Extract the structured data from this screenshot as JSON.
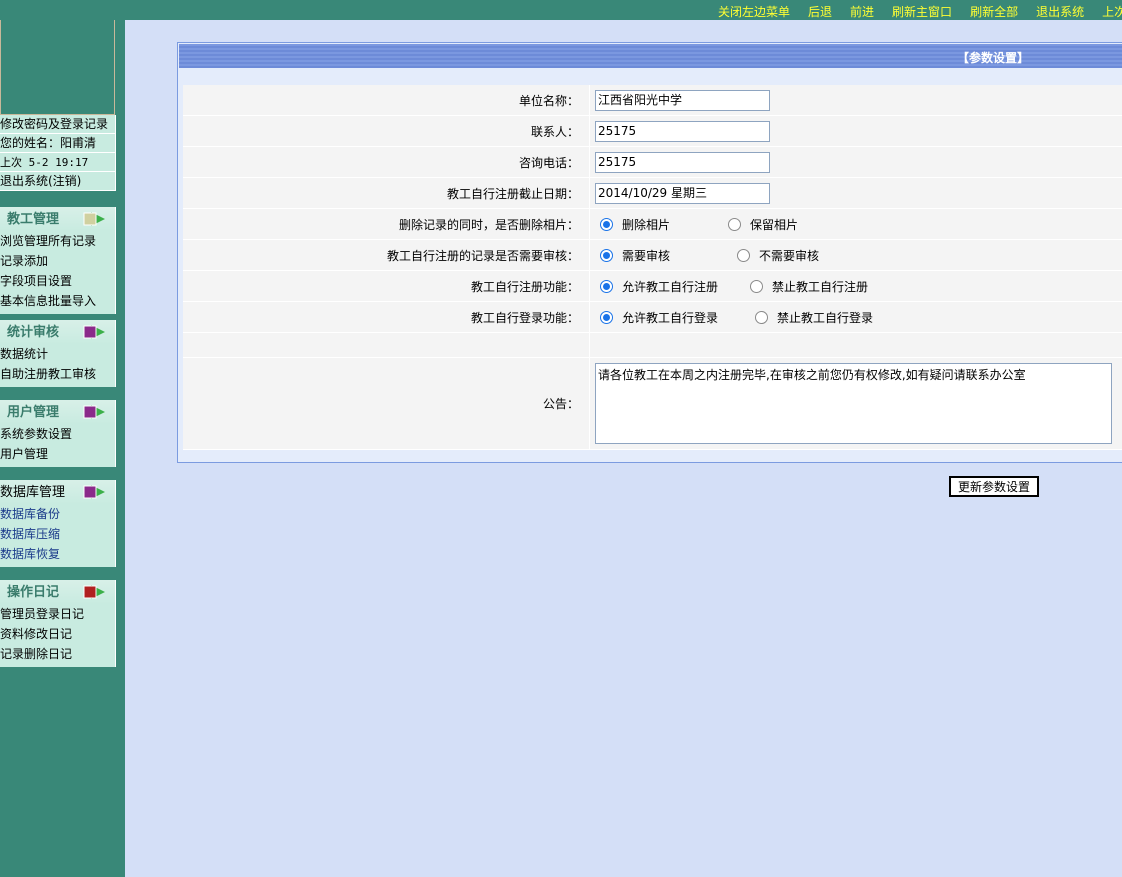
{
  "topbar": {
    "links": [
      "关闭左边菜单",
      "后退",
      "前进",
      "刷新主窗口",
      "刷新全部",
      "退出系统",
      "上次登录"
    ]
  },
  "sidebar": {
    "account": [
      "修改密码及登录记录",
      "您的姓名：阳甫清",
      "上次 5-2 19:17",
      "退出系统(注销)"
    ],
    "sections": [
      {
        "title": "教工管理",
        "items": [
          "浏览管理所有记录",
          "记录添加",
          "字段项目设置",
          "基本信息批量导入"
        ]
      },
      {
        "title": "统计审核",
        "items": [
          "数据统计",
          "自助注册教工审核"
        ]
      },
      {
        "title": "用户管理",
        "items": [
          "系统参数设置",
          "用户管理"
        ]
      },
      {
        "title": "数据库管理",
        "items": [
          "数据库备份",
          "数据库压缩",
          "数据库恢复"
        ]
      },
      {
        "title": "操作日记",
        "items": [
          "管理员登录日记",
          "资料修改日记",
          "记录删除日记"
        ]
      }
    ]
  },
  "panel": {
    "title": "【参数设置】",
    "fields": [
      {
        "label": "单位名称：",
        "value": "江西省阳光中学"
      },
      {
        "label": "联系人：",
        "value": "25175"
      },
      {
        "label": "咨询电话：",
        "value": "25175"
      },
      {
        "label": "教工自行注册截止日期：",
        "value": "2014/10/29 星期三"
      }
    ],
    "radios": [
      {
        "label": "删除记录的同时，是否删除相片：",
        "options": [
          "删除相片",
          "保留相片"
        ],
        "selected": 0
      },
      {
        "label": "教工自行注册的记录是否需要审核：",
        "options": [
          "需要审核",
          "不需要审核"
        ],
        "selected": 0
      },
      {
        "label": "教工自行注册功能：",
        "options": [
          "允许教工自行注册",
          "禁止教工自行注册"
        ],
        "selected": 0
      },
      {
        "label": "教工自行登录功能：",
        "options": [
          "允许教工自行登录",
          "禁止教工自行登录"
        ],
        "selected": 0
      }
    ],
    "notice_label": "公告：",
    "notice": "请各位教工在本周之内注册完毕,在审核之前您仍有权修改,如有疑问请联系办公室",
    "submit": "更新参数设置"
  }
}
